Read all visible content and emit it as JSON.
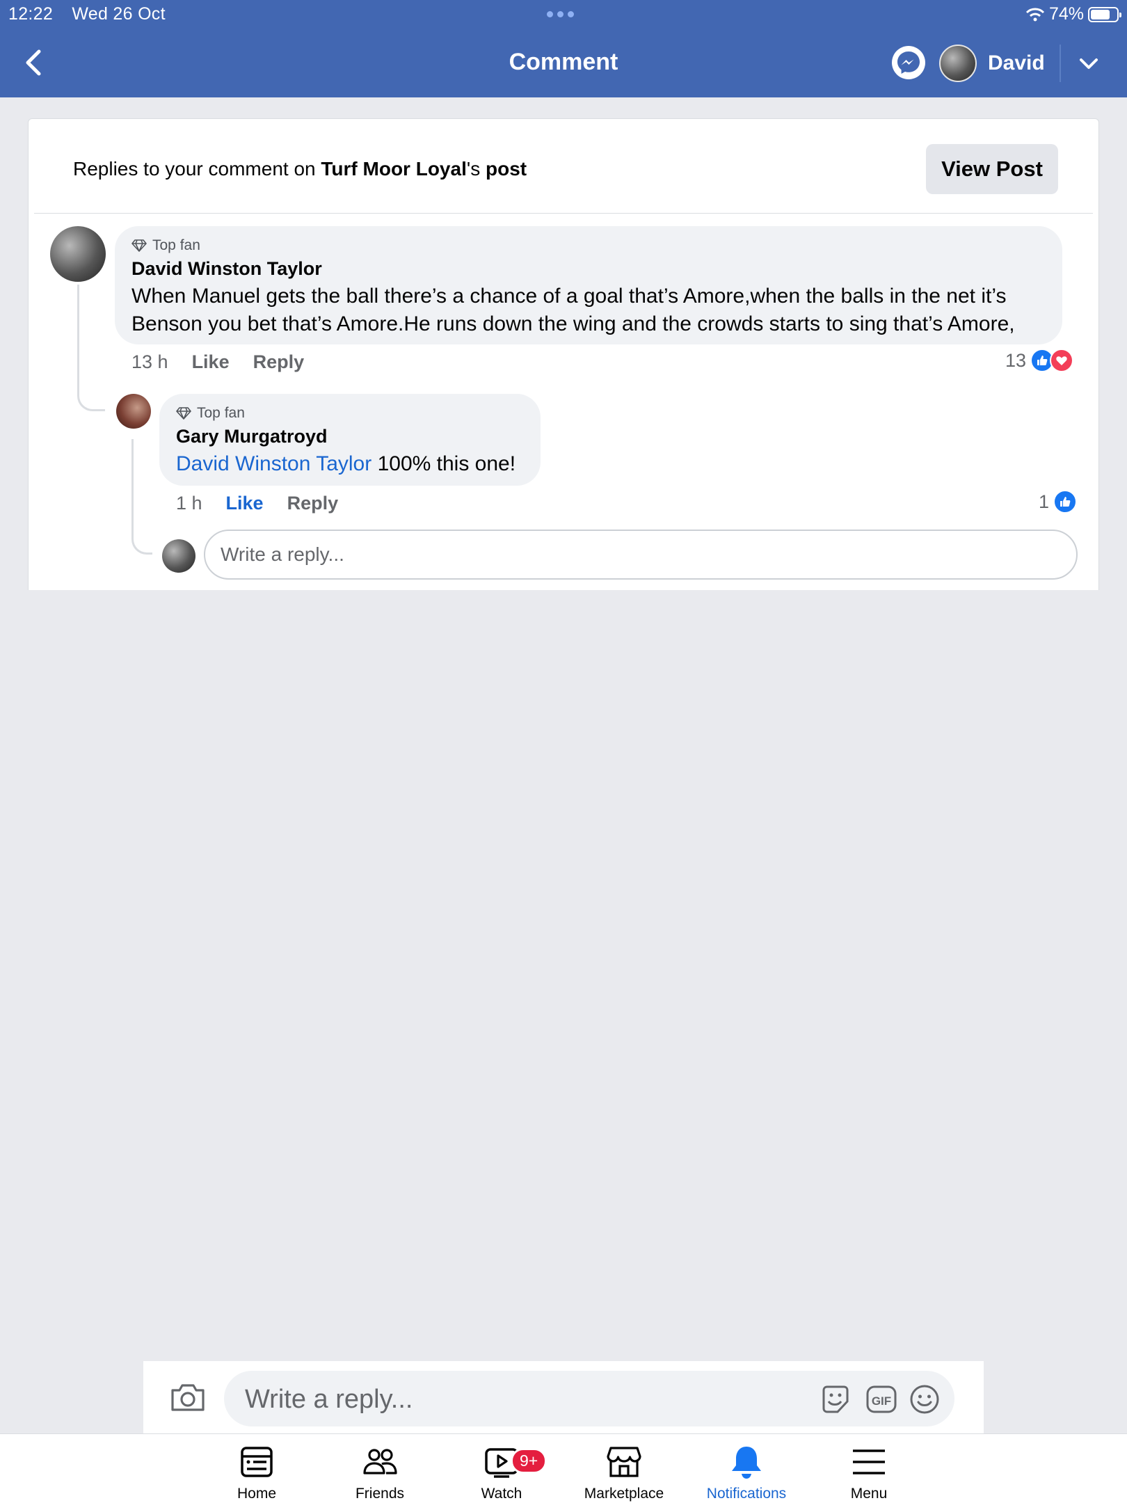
{
  "status_bar": {
    "time": "12:22",
    "date": "Wed 26 Oct",
    "battery": "74%",
    "battery_level": 0.74
  },
  "nav": {
    "title": "Comment",
    "profile_name": "David"
  },
  "card": {
    "header_prefix": "Replies to your comment on ",
    "header_page": "Turf Moor Loyal",
    "header_suffix_1": "'s ",
    "header_suffix_2": "post",
    "view_post_label": "View Post"
  },
  "comments": [
    {
      "badge": "Top fan",
      "author": "David Winston Taylor",
      "text": "When Manuel gets the ball there’s a chance of a goal that’s Amore,when the balls in the net it’s Benson you bet that’s Amore.He runs down the wing and the crowds starts to sing that’s Amore,",
      "time": "13 h",
      "like_label": "Like",
      "reply_label": "Reply",
      "reaction_count": "13"
    },
    {
      "badge": "Top fan",
      "author": "Gary Murgatroyd",
      "mention": "David Winston Taylor",
      "text": " 100% this one!",
      "time": "1 h",
      "like_label": "Like",
      "reply_label": "Reply",
      "reaction_count": "1"
    }
  ],
  "reply_box": {
    "placeholder": "Write a reply..."
  },
  "composer": {
    "placeholder": "Write a reply..."
  },
  "tabs": [
    {
      "label": "Home",
      "icon": "home-icon"
    },
    {
      "label": "Friends",
      "icon": "friends-icon"
    },
    {
      "label": "Watch",
      "icon": "watch-icon",
      "badge": "9+"
    },
    {
      "label": "Marketplace",
      "icon": "marketplace-icon"
    },
    {
      "label": "Notifications",
      "icon": "notifications-icon",
      "active": true
    },
    {
      "label": "Menu",
      "icon": "menu-icon"
    }
  ],
  "colors": {
    "brand": "#4267b2",
    "link": "#1a66d0",
    "like": "#1877f2",
    "love": "#f33e58",
    "badge": "#e41e3f"
  }
}
